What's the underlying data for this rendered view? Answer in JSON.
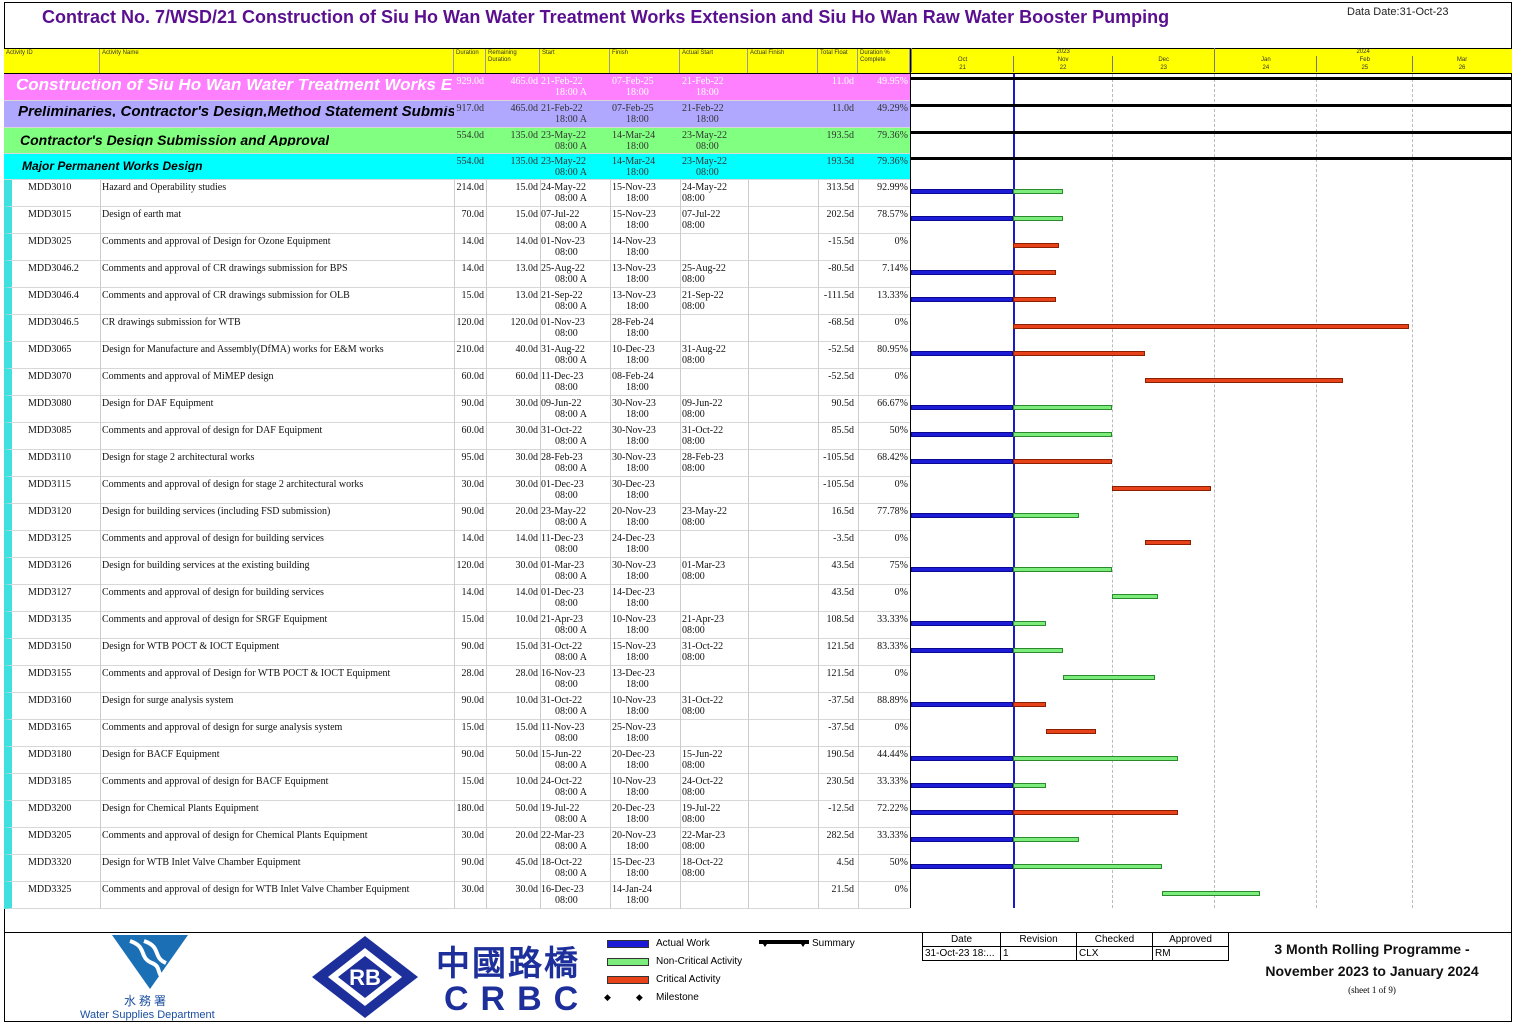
{
  "title": "Contract No. 7/WSD/21 Construction of Siu Ho Wan Water Treatment Works Extension and Siu Ho Wan Raw Water Booster Pumping",
  "data_date": "Data Date:31-Oct-23",
  "columns": [
    "Activity ID",
    "Activity Name",
    "Duration",
    "Remaining Duration",
    "Start",
    "Finish",
    "Actual Start",
    "Actual Finish",
    "Total Float",
    "Duration % Complete"
  ],
  "timescale": {
    "years": [
      "2023",
      "2024"
    ],
    "months": [
      "Oct",
      "Nov",
      "Dec",
      "Jan",
      "Feb",
      "Mar"
    ],
    "weeks": [
      "21",
      "22",
      "23",
      "24",
      "25",
      "26"
    ]
  },
  "groups": [
    {
      "name": "Construction of Siu Ho Wan Water Treatment Works Exte",
      "dur": "929.0d",
      "rem": "465.0d",
      "start": "21-Feb-22",
      "start2": "18:00 A",
      "finish": "07-Feb-25",
      "finish2": "18:00",
      "astart": "21-Feb-22",
      "astart2": "18:00",
      "tf": "11.0d",
      "pct": "49.95%",
      "color": "#ff80ff"
    },
    {
      "name": "Preliminaries, Contractor's Design,Method Statement Submissi",
      "dur": "917.0d",
      "rem": "465.0d",
      "start": "21-Feb-22",
      "start2": "18:00 A",
      "finish": "07-Feb-25",
      "finish2": "18:00",
      "astart": "21-Feb-22",
      "astart2": "18:00",
      "tf": "11.0d",
      "pct": "49.29%",
      "color": "#b0a8ff"
    },
    {
      "name": "Contractor's Design Submission and Approval",
      "dur": "554.0d",
      "rem": "135.0d",
      "start": "23-May-22",
      "start2": "08:00 A",
      "finish": "14-Mar-24",
      "finish2": "18:00",
      "astart": "23-May-22",
      "astart2": "08:00",
      "tf": "193.5d",
      "pct": "79.36%",
      "color": "#80ff80"
    },
    {
      "name": "Major Permanent Works Design",
      "dur": "554.0d",
      "rem": "135.0d",
      "start": "23-May-22",
      "start2": "08:00 A",
      "finish": "14-Mar-24",
      "finish2": "18:00",
      "astart": "23-May-22",
      "astart2": "08:00",
      "tf": "193.5d",
      "pct": "79.36%",
      "color": "#00ffff"
    }
  ],
  "activities": [
    {
      "id": "MDD3010",
      "name": "Hazard and Operability studies",
      "dur": "214.0d",
      "rem": "15.0d",
      "start": "24-May-22",
      "start2": "08:00 A",
      "finish": "15-Nov-23",
      "finish2": "18:00",
      "astart": "24-May-22",
      "astart2": "08:00",
      "tf": "313.5d",
      "pct": "92.99%"
    },
    {
      "id": "MDD3015",
      "name": "Design of earth mat",
      "dur": "70.0d",
      "rem": "15.0d",
      "start": "07-Jul-22",
      "start2": "08:00 A",
      "finish": "15-Nov-23",
      "finish2": "18:00",
      "astart": "07-Jul-22",
      "astart2": "08:00",
      "tf": "202.5d",
      "pct": "78.57%"
    },
    {
      "id": "MDD3025",
      "name": "Comments and approval of Design for Ozone Equipment",
      "dur": "14.0d",
      "rem": "14.0d",
      "start": "01-Nov-23",
      "start2": "08:00",
      "finish": "14-Nov-23",
      "finish2": "18:00",
      "astart": "",
      "astart2": "",
      "tf": "-15.5d",
      "pct": "0%"
    },
    {
      "id": "MDD3046.2",
      "name": "Comments and approval of CR drawings submission for BPS",
      "dur": "14.0d",
      "rem": "13.0d",
      "start": "25-Aug-22",
      "start2": "08:00 A",
      "finish": "13-Nov-23",
      "finish2": "18:00",
      "astart": "25-Aug-22",
      "astart2": "08:00",
      "tf": "-80.5d",
      "pct": "7.14%"
    },
    {
      "id": "MDD3046.4",
      "name": "Comments and approval of CR drawings submission for OLB",
      "dur": "15.0d",
      "rem": "13.0d",
      "start": "21-Sep-22",
      "start2": "08:00 A",
      "finish": "13-Nov-23",
      "finish2": "18:00",
      "astart": "21-Sep-22",
      "astart2": "08:00",
      "tf": "-111.5d",
      "pct": "13.33%"
    },
    {
      "id": "MDD3046.5",
      "name": "CR drawings submission for WTB",
      "dur": "120.0d",
      "rem": "120.0d",
      "start": "01-Nov-23",
      "start2": "08:00",
      "finish": "28-Feb-24",
      "finish2": "18:00",
      "astart": "",
      "astart2": "",
      "tf": "-68.5d",
      "pct": "0%"
    },
    {
      "id": "MDD3065",
      "name": "Design for Manufacture and Assembly(DfMA) works for E&M works",
      "dur": "210.0d",
      "rem": "40.0d",
      "start": "31-Aug-22",
      "start2": "08:00 A",
      "finish": "10-Dec-23",
      "finish2": "18:00",
      "astart": "31-Aug-22",
      "astart2": "08:00",
      "tf": "-52.5d",
      "pct": "80.95%"
    },
    {
      "id": "MDD3070",
      "name": "Comments and approval of MiMEP design",
      "dur": "60.0d",
      "rem": "60.0d",
      "start": "11-Dec-23",
      "start2": "08:00",
      "finish": "08-Feb-24",
      "finish2": "18:00",
      "astart": "",
      "astart2": "",
      "tf": "-52.5d",
      "pct": "0%"
    },
    {
      "id": "MDD3080",
      "name": "Design for DAF Equipment",
      "dur": "90.0d",
      "rem": "30.0d",
      "start": "09-Jun-22",
      "start2": "08:00 A",
      "finish": "30-Nov-23",
      "finish2": "18:00",
      "astart": "09-Jun-22",
      "astart2": "08:00",
      "tf": "90.5d",
      "pct": "66.67%"
    },
    {
      "id": "MDD3085",
      "name": "Comments and approval of design for DAF Equipment",
      "dur": "60.0d",
      "rem": "30.0d",
      "start": "31-Oct-22",
      "start2": "08:00 A",
      "finish": "30-Nov-23",
      "finish2": "18:00",
      "astart": "31-Oct-22",
      "astart2": "08:00",
      "tf": "85.5d",
      "pct": "50%"
    },
    {
      "id": "MDD3110",
      "name": "Design for stage 2 architectural works",
      "dur": "95.0d",
      "rem": "30.0d",
      "start": "28-Feb-23",
      "start2": "08:00 A",
      "finish": "30-Nov-23",
      "finish2": "18:00",
      "astart": "28-Feb-23",
      "astart2": "08:00",
      "tf": "-105.5d",
      "pct": "68.42%"
    },
    {
      "id": "MDD3115",
      "name": "Comments and approval of design for stage 2 architectural works",
      "dur": "30.0d",
      "rem": "30.0d",
      "start": "01-Dec-23",
      "start2": "08:00",
      "finish": "30-Dec-23",
      "finish2": "18:00",
      "astart": "",
      "astart2": "",
      "tf": "-105.5d",
      "pct": "0%"
    },
    {
      "id": "MDD3120",
      "name": "Design for building services (including FSD submission)",
      "dur": "90.0d",
      "rem": "20.0d",
      "start": "23-May-22",
      "start2": "08:00 A",
      "finish": "20-Nov-23",
      "finish2": "18:00",
      "astart": "23-May-22",
      "astart2": "08:00",
      "tf": "16.5d",
      "pct": "77.78%"
    },
    {
      "id": "MDD3125",
      "name": "Comments and approval of design for building services",
      "dur": "14.0d",
      "rem": "14.0d",
      "start": "11-Dec-23",
      "start2": "08:00",
      "finish": "24-Dec-23",
      "finish2": "18:00",
      "astart": "",
      "astart2": "",
      "tf": "-3.5d",
      "pct": "0%"
    },
    {
      "id": "MDD3126",
      "name": "Design for building services at the existing building",
      "dur": "120.0d",
      "rem": "30.0d",
      "start": "01-Mar-23",
      "start2": "08:00 A",
      "finish": "30-Nov-23",
      "finish2": "18:00",
      "astart": "01-Mar-23",
      "astart2": "08:00",
      "tf": "43.5d",
      "pct": "75%"
    },
    {
      "id": "MDD3127",
      "name": "Comments and approval of design for building services",
      "dur": "14.0d",
      "rem": "14.0d",
      "start": "01-Dec-23",
      "start2": "08:00",
      "finish": "14-Dec-23",
      "finish2": "18:00",
      "astart": "",
      "astart2": "",
      "tf": "43.5d",
      "pct": "0%"
    },
    {
      "id": "MDD3135",
      "name": "Comments and approval of design for SRGF Equipment",
      "dur": "15.0d",
      "rem": "10.0d",
      "start": "21-Apr-23",
      "start2": "08:00 A",
      "finish": "10-Nov-23",
      "finish2": "18:00",
      "astart": "21-Apr-23",
      "astart2": "08:00",
      "tf": "108.5d",
      "pct": "33.33%"
    },
    {
      "id": "MDD3150",
      "name": "Design for WTB POCT & IOCT Equipment",
      "dur": "90.0d",
      "rem": "15.0d",
      "start": "31-Oct-22",
      "start2": "08:00 A",
      "finish": "15-Nov-23",
      "finish2": "18:00",
      "astart": "31-Oct-22",
      "astart2": "08:00",
      "tf": "121.5d",
      "pct": "83.33%"
    },
    {
      "id": "MDD3155",
      "name": "Comments and approval of Design for WTB POCT & IOCT Equipment",
      "dur": "28.0d",
      "rem": "28.0d",
      "start": "16-Nov-23",
      "start2": "08:00",
      "finish": "13-Dec-23",
      "finish2": "18:00",
      "astart": "",
      "astart2": "",
      "tf": "121.5d",
      "pct": "0%"
    },
    {
      "id": "MDD3160",
      "name": "Design for surge analysis system",
      "dur": "90.0d",
      "rem": "10.0d",
      "start": "31-Oct-22",
      "start2": "08:00 A",
      "finish": "10-Nov-23",
      "finish2": "18:00",
      "astart": "31-Oct-22",
      "astart2": "08:00",
      "tf": "-37.5d",
      "pct": "88.89%"
    },
    {
      "id": "MDD3165",
      "name": "Comments and approval of design for surge analysis system",
      "dur": "15.0d",
      "rem": "15.0d",
      "start": "11-Nov-23",
      "start2": "08:00",
      "finish": "25-Nov-23",
      "finish2": "18:00",
      "astart": "",
      "astart2": "",
      "tf": "-37.5d",
      "pct": "0%"
    },
    {
      "id": "MDD3180",
      "name": "Design for BACF Equipment",
      "dur": "90.0d",
      "rem": "50.0d",
      "start": "15-Jun-22",
      "start2": "08:00 A",
      "finish": "20-Dec-23",
      "finish2": "18:00",
      "astart": "15-Jun-22",
      "astart2": "08:00",
      "tf": "190.5d",
      "pct": "44.44%"
    },
    {
      "id": "MDD3185",
      "name": "Comments and approval of design for BACF Equipment",
      "dur": "15.0d",
      "rem": "10.0d",
      "start": "24-Oct-22",
      "start2": "08:00 A",
      "finish": "10-Nov-23",
      "finish2": "18:00",
      "astart": "24-Oct-22",
      "astart2": "08:00",
      "tf": "230.5d",
      "pct": "33.33%"
    },
    {
      "id": "MDD3200",
      "name": "Design for Chemical Plants Equipment",
      "dur": "180.0d",
      "rem": "50.0d",
      "start": "19-Jul-22",
      "start2": "08:00 A",
      "finish": "20-Dec-23",
      "finish2": "18:00",
      "astart": "19-Jul-22",
      "astart2": "08:00",
      "tf": "-12.5d",
      "pct": "72.22%"
    },
    {
      "id": "MDD3205",
      "name": "Comments and approval of design for Chemical Plants Equipment",
      "dur": "30.0d",
      "rem": "20.0d",
      "start": "22-Mar-23",
      "start2": "08:00 A",
      "finish": "20-Nov-23",
      "finish2": "18:00",
      "astart": "22-Mar-23",
      "astart2": "08:00",
      "tf": "282.5d",
      "pct": "33.33%"
    },
    {
      "id": "MDD3320",
      "name": "Design for WTB Inlet Valve Chamber Equipment",
      "dur": "90.0d",
      "rem": "45.0d",
      "start": "18-Oct-22",
      "start2": "08:00 A",
      "finish": "15-Dec-23",
      "finish2": "18:00",
      "astart": "18-Oct-22",
      "astart2": "08:00",
      "tf": "4.5d",
      "pct": "50%"
    },
    {
      "id": "MDD3325",
      "name": "Comments and approval of design for WTB Inlet Valve Chamber Equipment",
      "dur": "30.0d",
      "rem": "30.0d",
      "start": "16-Dec-23",
      "start2": "08:00",
      "finish": "14-Jan-24",
      "finish2": "18:00",
      "astart": "",
      "astart2": "",
      "tf": "21.5d",
      "pct": "0%"
    }
  ],
  "chart_bars": [
    {
      "actual": true,
      "rem_type": "nc",
      "rem_start": "2023-11-01",
      "rem_end": "2023-11-15"
    },
    {
      "actual": true,
      "rem_type": "nc",
      "rem_start": "2023-11-01",
      "rem_end": "2023-11-15"
    },
    {
      "actual": false,
      "rem_type": "cr",
      "rem_start": "2023-11-01",
      "rem_end": "2023-11-14"
    },
    {
      "actual": true,
      "rem_type": "cr",
      "rem_start": "2023-11-01",
      "rem_end": "2023-11-13"
    },
    {
      "actual": true,
      "rem_type": "cr",
      "rem_start": "2023-11-01",
      "rem_end": "2023-11-13"
    },
    {
      "actual": false,
      "rem_type": "cr",
      "rem_start": "2023-11-01",
      "rem_end": "2024-02-28"
    },
    {
      "actual": true,
      "rem_type": "cr",
      "rem_start": "2023-11-01",
      "rem_end": "2023-12-10"
    },
    {
      "actual": false,
      "rem_type": "cr",
      "rem_start": "2023-12-11",
      "rem_end": "2024-02-08"
    },
    {
      "actual": true,
      "rem_type": "nc",
      "rem_start": "2023-11-01",
      "rem_end": "2023-11-30"
    },
    {
      "actual": true,
      "rem_type": "nc",
      "rem_start": "2023-11-01",
      "rem_end": "2023-11-30"
    },
    {
      "actual": true,
      "rem_type": "cr",
      "rem_start": "2023-11-01",
      "rem_end": "2023-11-30"
    },
    {
      "actual": false,
      "rem_type": "cr",
      "rem_start": "2023-12-01",
      "rem_end": "2023-12-30"
    },
    {
      "actual": true,
      "rem_type": "nc",
      "rem_start": "2023-11-01",
      "rem_end": "2023-11-20"
    },
    {
      "actual": false,
      "rem_type": "cr",
      "rem_start": "2023-12-11",
      "rem_end": "2023-12-24"
    },
    {
      "actual": true,
      "rem_type": "nc",
      "rem_start": "2023-11-01",
      "rem_end": "2023-11-30"
    },
    {
      "actual": false,
      "rem_type": "nc",
      "rem_start": "2023-12-01",
      "rem_end": "2023-12-14"
    },
    {
      "actual": true,
      "rem_type": "nc",
      "rem_start": "2023-11-01",
      "rem_end": "2023-11-10"
    },
    {
      "actual": true,
      "rem_type": "nc",
      "rem_start": "2023-11-01",
      "rem_end": "2023-11-15"
    },
    {
      "actual": false,
      "rem_type": "nc",
      "rem_start": "2023-11-16",
      "rem_end": "2023-12-13"
    },
    {
      "actual": true,
      "rem_type": "cr",
      "rem_start": "2023-11-01",
      "rem_end": "2023-11-10"
    },
    {
      "actual": false,
      "rem_type": "cr",
      "rem_start": "2023-11-11",
      "rem_end": "2023-11-25"
    },
    {
      "actual": true,
      "rem_type": "nc",
      "rem_start": "2023-11-01",
      "rem_end": "2023-12-20"
    },
    {
      "actual": true,
      "rem_type": "nc",
      "rem_start": "2023-11-01",
      "rem_end": "2023-11-10"
    },
    {
      "actual": true,
      "rem_type": "cr",
      "rem_start": "2023-11-01",
      "rem_end": "2023-12-20"
    },
    {
      "actual": true,
      "rem_type": "nc",
      "rem_start": "2023-11-01",
      "rem_end": "2023-11-20"
    },
    {
      "actual": true,
      "rem_type": "nc",
      "rem_start": "2023-11-01",
      "rem_end": "2023-12-15"
    },
    {
      "actual": false,
      "rem_type": "nc",
      "rem_start": "2023-12-16",
      "rem_end": "2024-01-14"
    }
  ],
  "legend": {
    "actual_work": "Actual Work",
    "non_critical": "Non-Critical Activity",
    "critical": "Critical Activity",
    "milestone": "Milestone",
    "summary": "Summary"
  },
  "colors": {
    "actual": "#1c1cd6",
    "non_critical": "#7ced7c",
    "critical": "#e8421a",
    "title": "#5a0f8f"
  },
  "wsd": {
    "chinese": "水 務 署",
    "english": "Water Supplies Department"
  },
  "crbc": {
    "badge": "RB",
    "chinese": "中國路橋",
    "english": "CRBC"
  },
  "revision": {
    "headers": [
      "Date",
      "Revision",
      "Checked",
      "Approved"
    ],
    "values": [
      "31-Oct-23 18:...",
      "1",
      "CLX",
      "RM"
    ]
  },
  "programme": {
    "line1": "3 Month Rolling Programme -",
    "line2": "November 2023 to January 2024",
    "sheet": "(sheet 1 of 9)"
  }
}
